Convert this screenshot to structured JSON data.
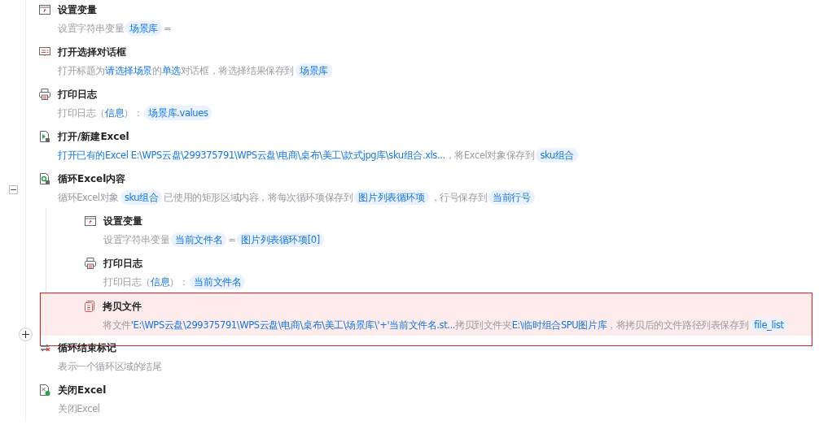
{
  "steps": [
    {
      "kind": "variable",
      "title": "设置变量",
      "selected": false,
      "desc": [
        {
          "kind": "text",
          "text": "设置字符串变量"
        },
        {
          "kind": "var",
          "text": "场景库"
        },
        {
          "kind": "text",
          "text": "="
        }
      ]
    },
    {
      "kind": "dialog",
      "title": "打开选择对话框",
      "selected": false,
      "desc": [
        {
          "kind": "text",
          "text": "打开标题为"
        },
        {
          "kind": "value",
          "text": "请选择场景"
        },
        {
          "kind": "text",
          "text": "的"
        },
        {
          "kind": "value",
          "text": "单选"
        },
        {
          "kind": "text",
          "text": "对话框，将选择结果保存到"
        },
        {
          "kind": "var",
          "text": "场景库"
        }
      ]
    },
    {
      "kind": "print",
      "title": "打印日志",
      "selected": false,
      "desc": [
        {
          "kind": "text",
          "text": "打印日志（"
        },
        {
          "kind": "value",
          "text": "信息"
        },
        {
          "kind": "text",
          "text": "）："
        },
        {
          "kind": "var",
          "text": "场景库.values"
        }
      ]
    },
    {
      "kind": "excel-open",
      "title": "打开/新建Excel",
      "selected": false,
      "desc": [
        {
          "kind": "value",
          "text": "打开已有的Excel E:\\WPS云盘\\299375791\\WPS云盘\\电商\\桌布\\美工\\款式jpg库\\sku组合.xls..."
        },
        {
          "kind": "text",
          "text": "，将Excel对象保存到"
        },
        {
          "kind": "var",
          "text": "sku组合"
        }
      ]
    },
    {
      "kind": "excel-loop",
      "title": "循环Excel内容",
      "selected": false,
      "expanded": true,
      "desc": [
        {
          "kind": "text",
          "text": "循环Excel对象"
        },
        {
          "kind": "var",
          "text": "sku组合"
        },
        {
          "kind": "text",
          "text": "已使用的矩形区域内容，将每次循环项保存到"
        },
        {
          "kind": "var",
          "text": "图片列表循环项"
        },
        {
          "kind": "text",
          "text": "，行号保存到"
        },
        {
          "kind": "var",
          "text": "当前行号"
        }
      ],
      "children": [
        {
          "kind": "variable",
          "title": "设置变量",
          "selected": false,
          "desc": [
            {
              "kind": "text",
              "text": "设置字符串变量"
            },
            {
              "kind": "var",
              "text": "当前文件名"
            },
            {
              "kind": "text",
              "text": "="
            },
            {
              "kind": "var",
              "text": "图片列表循环项[0]"
            }
          ]
        },
        {
          "kind": "print",
          "title": "打印日志",
          "selected": false,
          "desc": [
            {
              "kind": "text",
              "text": "打印日志（"
            },
            {
              "kind": "value",
              "text": "信息"
            },
            {
              "kind": "text",
              "text": "）："
            },
            {
              "kind": "var",
              "text": "当前文件名"
            }
          ]
        },
        {
          "kind": "copy",
          "title": "拷贝文件",
          "selected": true,
          "desc": [
            {
              "kind": "text",
              "text": "将文件"
            },
            {
              "kind": "value",
              "text": "'E:\\WPS云盘\\299375791\\WPS云盘\\电商\\桌布\\美工\\场景库\\'+'当前文件名.st..."
            },
            {
              "kind": "text",
              "text": "拷贝到文件夹"
            },
            {
              "kind": "value",
              "text": "E:\\临时组合SPU图片库"
            },
            {
              "kind": "text",
              "text": "，将拷贝后的文件路径列表保存到"
            },
            {
              "kind": "var",
              "text": "file_list"
            }
          ]
        }
      ]
    },
    {
      "kind": "loop-end",
      "title": "循环结束标记",
      "selected": false,
      "desc": [
        {
          "kind": "text",
          "text": "表示一个循环区域的结尾"
        }
      ]
    },
    {
      "kind": "excel-close",
      "title": "关闭Excel",
      "selected": false,
      "desc": [
        {
          "kind": "text",
          "text": "关闭Excel"
        }
      ]
    }
  ]
}
